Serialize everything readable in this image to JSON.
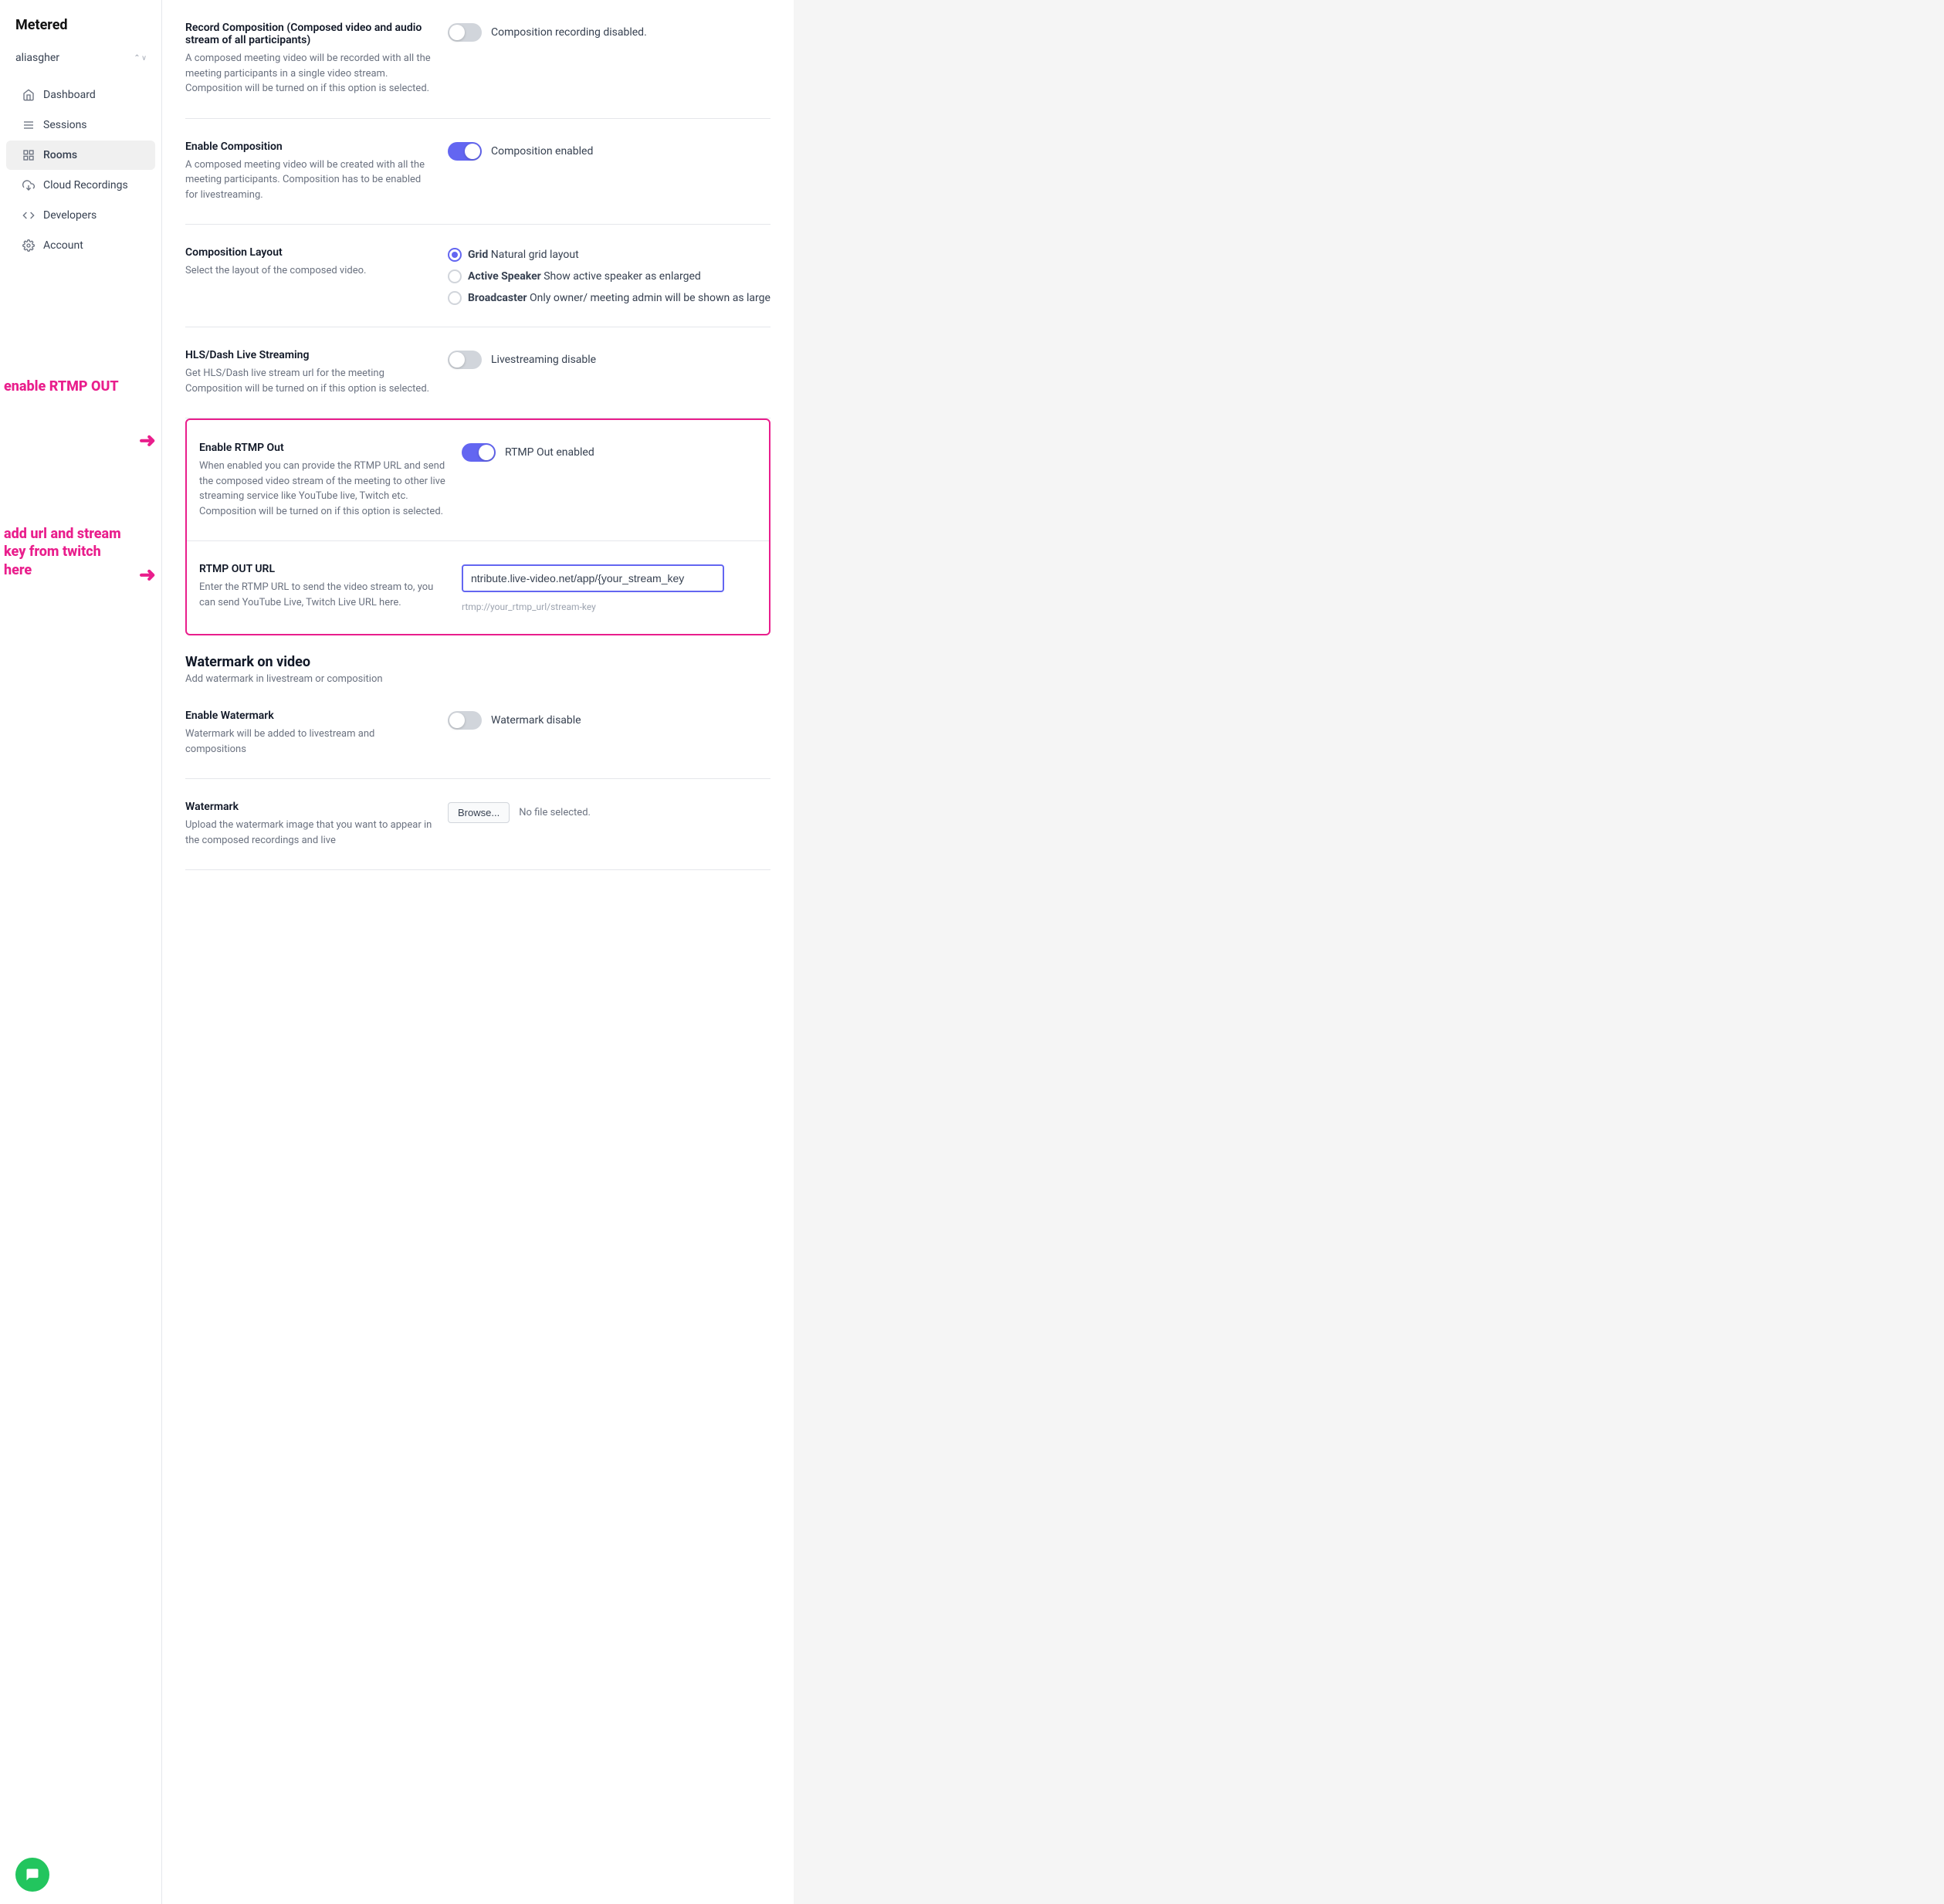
{
  "sidebar": {
    "logo": "Metered",
    "user": "aliasgher",
    "items": [
      {
        "label": "Dashboard",
        "icon": "home",
        "active": false
      },
      {
        "label": "Sessions",
        "icon": "menu",
        "active": false
      },
      {
        "label": "Rooms",
        "icon": "grid",
        "active": true
      },
      {
        "label": "Cloud Recordings",
        "icon": "cloud",
        "active": false
      },
      {
        "label": "Developers",
        "icon": "code",
        "active": false
      },
      {
        "label": "Account",
        "icon": "gear",
        "active": false
      }
    ]
  },
  "settings": {
    "record_composition": {
      "label": "Record Composition (Composed video and audio stream of all participants)",
      "desc": "A composed meeting video will be recorded with all the meeting participants in a single video stream. Composition will be turned on if this option is selected.",
      "toggle_state": "off",
      "status_text": "Composition recording disabled."
    },
    "enable_composition": {
      "label": "Enable Composition",
      "desc": "A composed meeting video will be created with all the meeting participants. Composition has to be enabled for livestreaming.",
      "toggle_state": "on",
      "status_text": "Composition enabled"
    },
    "composition_layout": {
      "label": "Composition Layout",
      "desc": "Select the layout of the composed video.",
      "options": [
        {
          "label": "Grid",
          "sublabel": "Natural grid layout",
          "selected": true
        },
        {
          "label": "Active Speaker",
          "sublabel": "Show active speaker as enlarged",
          "selected": false
        },
        {
          "label": "Broadcaster",
          "sublabel": "Only owner/ meeting admin will be shown as large",
          "selected": false
        }
      ]
    },
    "hls_dash": {
      "label": "HLS/Dash Live Streaming",
      "desc": "Get HLS/Dash live stream url for the meeting Composition will be turned on if this option is selected.",
      "toggle_state": "off",
      "status_text": "Livestreaming disable"
    },
    "rtmp_out": {
      "label": "Enable RTMP Out",
      "desc": "When enabled you can provide the RTMP URL and send the composed video stream of the meeting to other live streaming service like YouTube live, Twitch etc. Composition will be turned on if this option is selected.",
      "toggle_state": "on",
      "status_text": "RTMP Out enabled"
    },
    "rtmp_url": {
      "label": "RTMP OUT URL",
      "desc": "Enter the RTMP URL to send the video stream to, you can send YouTube Live, Twitch Live URL here.",
      "input_value": "ntribute.live-video.net/app/{your_stream_key",
      "hint_text": "rtmp://your_rtmp_url/stream-key"
    },
    "watermark_section": {
      "title": "Watermark on video",
      "subtitle": "Add watermark in livestream or composition"
    },
    "enable_watermark": {
      "label": "Enable Watermark",
      "desc": "Watermark will be added to livestream and compositions",
      "toggle_state": "off",
      "status_text": "Watermark disable"
    },
    "watermark_file": {
      "label": "Watermark",
      "desc": "Upload the watermark image that you want to appear in the composed recordings and live",
      "browse_label": "Browse...",
      "no_file_text": "No file selected."
    }
  },
  "annotations": {
    "ann1": "enable RTMP OUT",
    "ann2": "add url and stream\nkey from twitch\nhere"
  }
}
